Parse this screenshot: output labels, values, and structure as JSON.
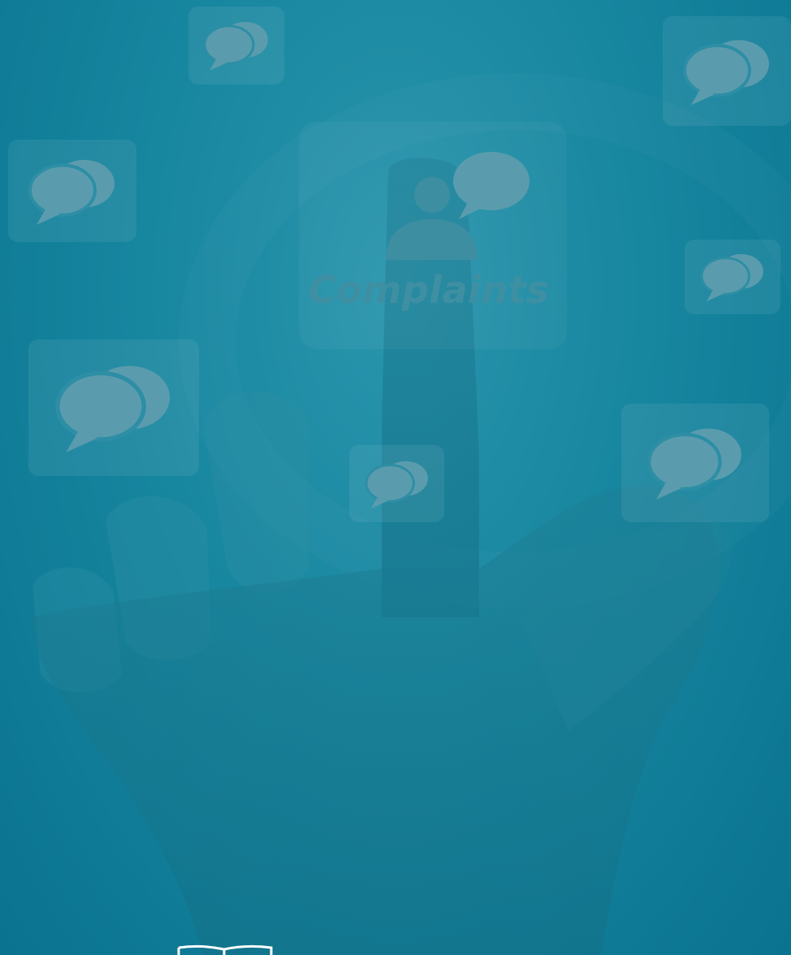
{
  "headline": {
    "text": "Complaints"
  },
  "colors": {
    "background": "#17869f",
    "icon_fill": "#5a9cad",
    "text": "#3f8fa3"
  },
  "icons": [
    "speech-bubbles-icon",
    "person-icon",
    "speech-bubble-icon",
    "shield-logo-icon"
  ]
}
